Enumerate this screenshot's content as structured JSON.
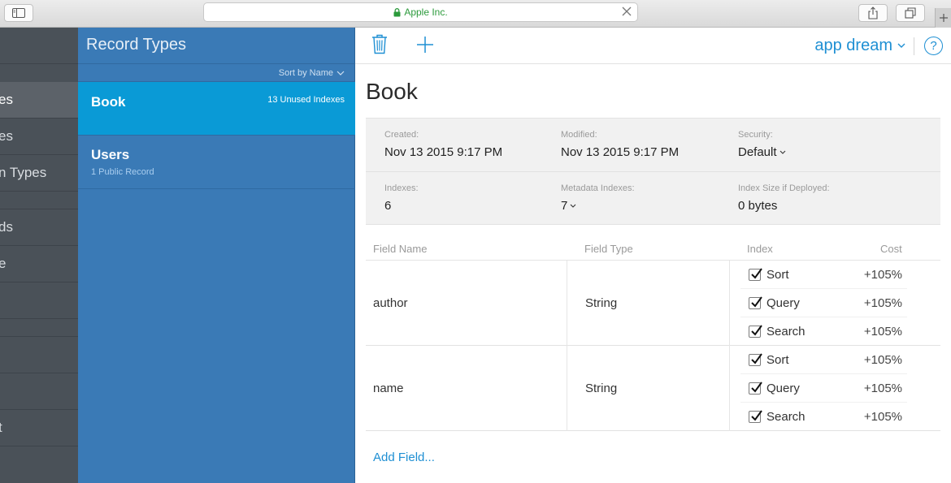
{
  "browser": {
    "url_text": "Apple Inc.",
    "colors": {
      "secure": "#2b9a3b"
    }
  },
  "sidebar": {
    "items": [
      {
        "label": "es",
        "active": true
      },
      {
        "label": "es"
      },
      {
        "label": "n Types"
      },
      {
        "label": "ds"
      },
      {
        "label": "e"
      },
      {
        "label": ""
      },
      {
        "label": ""
      },
      {
        "label": ""
      },
      {
        "label": "t"
      }
    ]
  },
  "record_types": {
    "title": "Record Types",
    "sort_label": "Sort by Name",
    "items": [
      {
        "name": "Book",
        "badge": "13 Unused Indexes",
        "selected": true
      },
      {
        "name": "Users",
        "sub": "1 Public Record"
      }
    ]
  },
  "toolbar": {
    "container_name": "app dream",
    "help_label": "?"
  },
  "record": {
    "title": "Book",
    "created_label": "Created:",
    "created_value": "Nov 13 2015 9:17 PM",
    "modified_label": "Modified:",
    "modified_value": "Nov 13 2015 9:17 PM",
    "security_label": "Security:",
    "security_value": "Default",
    "indexes_label": "Indexes:",
    "indexes_value": "6",
    "metadata_label": "Metadata Indexes:",
    "metadata_value": "7",
    "size_label": "Index Size if Deployed:",
    "size_value": "0 bytes"
  },
  "fields_table": {
    "headers": {
      "name": "Field Name",
      "type": "Field Type",
      "index": "Index",
      "cost": "Cost"
    },
    "rows": [
      {
        "name": "author",
        "type": "String",
        "indexes": [
          {
            "label": "Sort",
            "checked": true,
            "cost": "+105%"
          },
          {
            "label": "Query",
            "checked": true,
            "cost": "+105%"
          },
          {
            "label": "Search",
            "checked": true,
            "cost": "+105%"
          }
        ]
      },
      {
        "name": "name",
        "type": "String",
        "indexes": [
          {
            "label": "Sort",
            "checked": true,
            "cost": "+105%"
          },
          {
            "label": "Query",
            "checked": true,
            "cost": "+105%"
          },
          {
            "label": "Search",
            "checked": true,
            "cost": "+105%"
          }
        ]
      }
    ],
    "add_field_label": "Add Field..."
  },
  "colors": {
    "accent": "#1e8fd3",
    "selected_row": "#0a9ad6",
    "list_bg": "#3a7ab6",
    "sidebar_bg": "#4a5158"
  }
}
